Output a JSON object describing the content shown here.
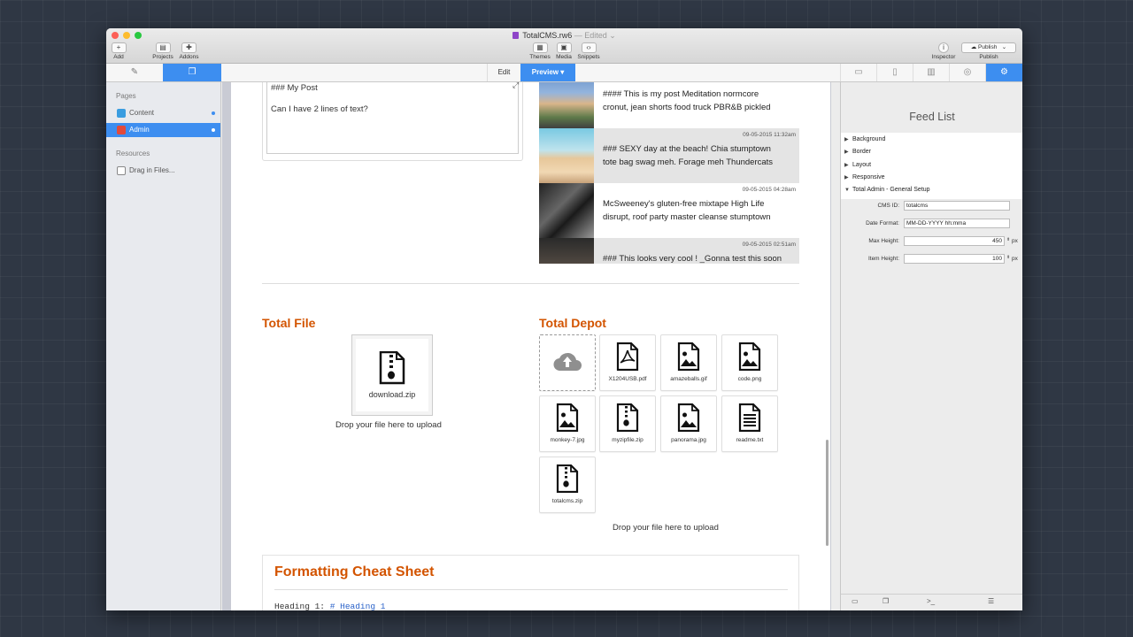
{
  "window": {
    "title": "TotalCMS.rw6",
    "edited": "— Edited ⌄"
  },
  "toolbar": {
    "add": "Add",
    "projects": "Projects",
    "addons": "Addons",
    "themes": "Themes",
    "media": "Media",
    "snippets": "Snippets",
    "inspector": "Inspector",
    "publish_button": "Publish",
    "publish": "Publish"
  },
  "modes": {
    "edit": "Edit",
    "preview": "Preview ▾"
  },
  "sidebar": {
    "pages_heading": "Pages",
    "pages": [
      {
        "label": "Content",
        "icon_color": "#3a9de0"
      },
      {
        "label": "Admin",
        "icon_color": "#e24a3b"
      }
    ],
    "resources_heading": "Resources",
    "resources": [
      {
        "label": "Drag in Files..."
      }
    ]
  },
  "post": {
    "line1": "### My Post",
    "line2": "Can I have 2 lines of text?"
  },
  "feed": [
    {
      "date": "",
      "line1": "#### This is my post Meditation normcore",
      "line2": "cronut, jean shorts food truck PBR&B pickled"
    },
    {
      "date": "09-05-2015 11:32am",
      "line1": "### SEXY day at the beach! Chia stumptown",
      "line2": "tote bag swag meh. Forage meh Thundercats"
    },
    {
      "date": "09-05-2015 04:28am",
      "line1": "McSweeney's gluten-free mixtape High Life",
      "line2": "disrupt, roof party master cleanse stumptown"
    },
    {
      "date": "09-05-2015 02:51am",
      "line1": "### This looks very cool ! _Gonna test this soon",
      "line2": ""
    }
  ],
  "total_file": {
    "heading": "Total File",
    "filename": "download.zip",
    "drop": "Drop your file here to upload"
  },
  "total_depot": {
    "heading": "Total Depot",
    "files": [
      {
        "name": "X1204USB.pdf",
        "icon": "pdf-file-icon"
      },
      {
        "name": "amazeballs.gif",
        "icon": "image-file-icon"
      },
      {
        "name": "code.png",
        "icon": "image-file-icon"
      },
      {
        "name": "monkey-7.jpg",
        "icon": "image-file-icon"
      },
      {
        "name": "myzipfile.zip",
        "icon": "zip-file-icon"
      },
      {
        "name": "panorama.jpg",
        "icon": "image-file-icon"
      },
      {
        "name": "readme.txt",
        "icon": "text-file-icon"
      },
      {
        "name": "totalcms.zip",
        "icon": "zip-file-icon"
      }
    ],
    "drop": "Drop your file here to upload"
  },
  "cheat": {
    "title": "Formatting Cheat Sheet",
    "code_label": "Heading 1: ",
    "code_value": "# Heading 1"
  },
  "inspector": {
    "title": "Feed List",
    "sections": [
      "Background",
      "Border",
      "Layout",
      "Responsive",
      "Total Admin - General Setup"
    ],
    "cms_id_label": "CMS ID:",
    "cms_id_value": "totalcms",
    "date_format_label": "Date Format:",
    "date_format_value": "MM-DD-YYYY hh:mma",
    "max_height_label": "Max Height:",
    "max_height_value": "450",
    "item_height_label": "Item Height:",
    "item_height_value": "100",
    "unit": "px"
  },
  "colors": {
    "accent": "#3d8ef0",
    "heading": "#d35400"
  }
}
